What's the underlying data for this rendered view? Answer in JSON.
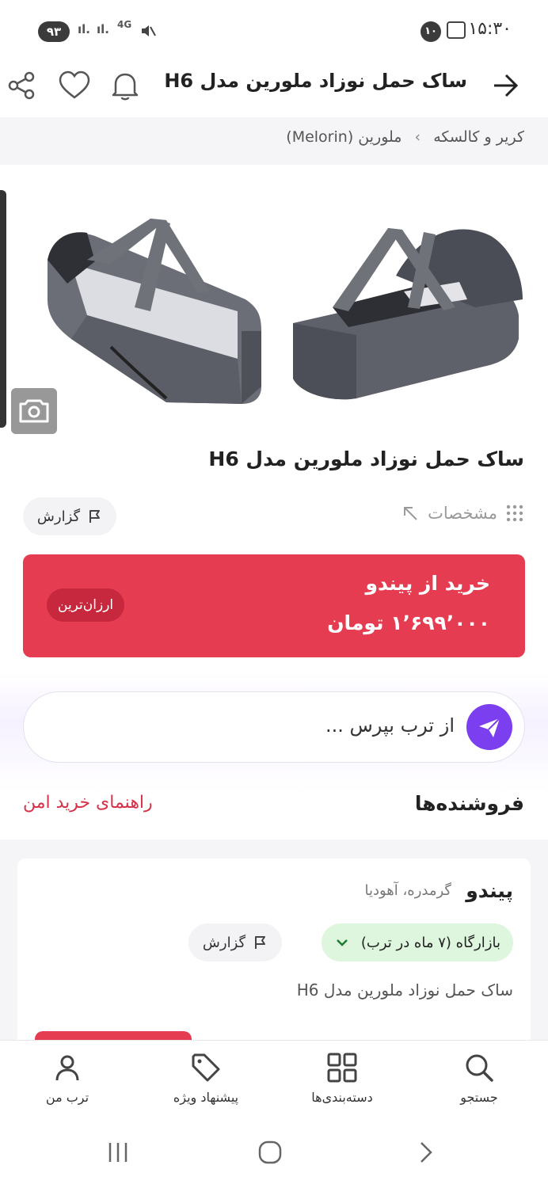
{
  "status_bar": {
    "battery": "۹۳",
    "network": "4G",
    "notification_count": "۱۰",
    "time": "۱۵:۳۰"
  },
  "header": {
    "title": "ساک حمل نوزاد ملورین مدل H6",
    "icons": [
      "back-arrow-icon",
      "bell-icon",
      "heart-icon",
      "share-icon"
    ]
  },
  "breadcrumb": {
    "items": [
      "کریر و کالسکه",
      "ملورین (Melorin)"
    ],
    "separator": "›"
  },
  "product": {
    "title": "ساک حمل نوزاد ملورین مدل H6",
    "specs_label": "مشخصات",
    "report_label": "گزارش"
  },
  "buy_card": {
    "title": "خرید از پیندو",
    "price": "۱٬۶۹۹٬۰۰۰ تومان",
    "badge": "ارزان‌ترین",
    "color": "#e63c51"
  },
  "ask": {
    "placeholder": "از ترب بپرس ..."
  },
  "sellers": {
    "title": "فروشنده‌ها",
    "safe_guide": "راهنمای خرید امن",
    "items": [
      {
        "name": "پیندو",
        "location": "گرمدره، آهودیا",
        "badge": "بازارگاه (۷ ماه در ترب)",
        "report_label": "گزارش",
        "product": "ساک حمل نوزاد ملورین مدل H6"
      }
    ]
  },
  "bottom_nav": {
    "items": [
      {
        "label": "ترب من",
        "icon": "user-icon"
      },
      {
        "label": "پیشنهاد ویژه",
        "icon": "tag-icon"
      },
      {
        "label": "دسته‌بندی‌ها",
        "icon": "grid-icon"
      },
      {
        "label": "جستجو",
        "icon": "search-icon"
      }
    ]
  }
}
